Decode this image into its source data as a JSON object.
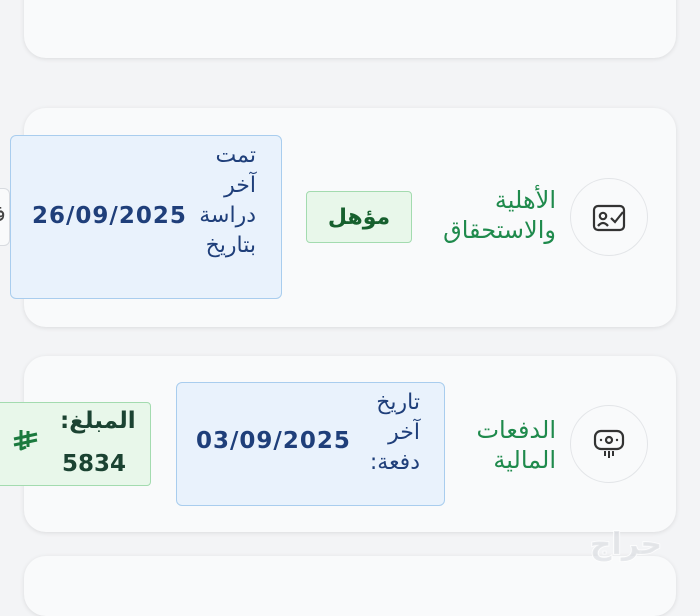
{
  "eligibility": {
    "title": "الأهلية\nوالاستحقاق",
    "icon": "id-card-check-icon",
    "status_badge": "مؤهل",
    "date_label": "تمت\nآخر\nدراسة\nبتاريخ",
    "date_value": "26/09/2025",
    "edge_chip_glyph": "ف"
  },
  "payments": {
    "title": "الدفعات\nالمالية",
    "icon": "payment-terminal-icon",
    "date_label": "تاريخ\nآخر\nدفعة:",
    "date_value": "03/09/2025",
    "amount_label": "المبلغ:",
    "amount_value": "5834",
    "currency_icon": "saudi-riyal-symbol-icon"
  },
  "watermark": {
    "text": "حراج",
    "icon": "haraj-watermark-logo"
  },
  "colors": {
    "title_green": "#1f8a4c",
    "date_blue": "#1f3f7a",
    "date_bg": "#e9f2fc",
    "badge_bg": "#e8f7ea",
    "card_bg": "#f9fafb"
  }
}
